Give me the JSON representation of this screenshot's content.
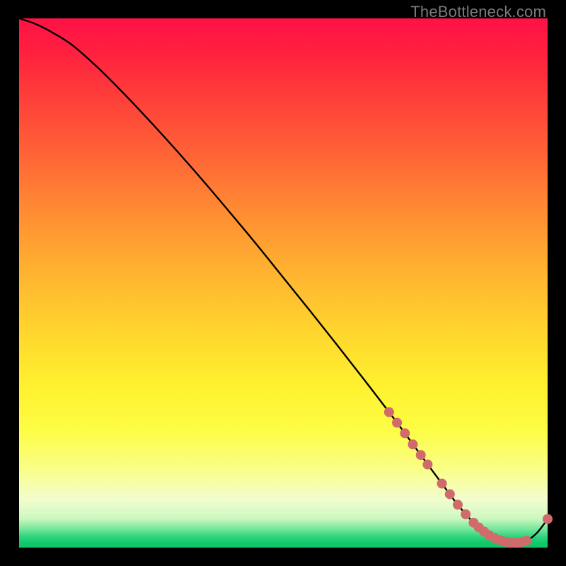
{
  "watermark": "TheBottleneck.com",
  "chart_data": {
    "type": "line",
    "title": "",
    "xlabel": "",
    "ylabel": "",
    "xlim": [
      0,
      100
    ],
    "ylim": [
      0,
      100
    ],
    "grid": false,
    "legend": false,
    "series": [
      {
        "name": "bottleneck-curve",
        "color": "#000000",
        "x": [
          0,
          3,
          6,
          10,
          15,
          20,
          25,
          30,
          35,
          40,
          45,
          50,
          55,
          60,
          65,
          70,
          73,
          76,
          80,
          83,
          86,
          88,
          90,
          92,
          94,
          96,
          98,
          100
        ],
        "y": [
          100,
          99,
          97.5,
          95,
          90.6,
          85.6,
          80.3,
          74.8,
          69.1,
          63.2,
          57.2,
          51.0,
          44.8,
          38.5,
          32.1,
          25.6,
          21.6,
          17.5,
          12.1,
          8.1,
          4.7,
          3.0,
          1.8,
          1.1,
          0.9,
          1.3,
          2.8,
          5.4
        ]
      }
    ],
    "markers": [
      {
        "x": 70.0,
        "y": 25.6
      },
      {
        "x": 71.5,
        "y": 23.6
      },
      {
        "x": 73.0,
        "y": 21.6
      },
      {
        "x": 74.5,
        "y": 19.5
      },
      {
        "x": 76.0,
        "y": 17.5
      },
      {
        "x": 77.3,
        "y": 15.7
      },
      {
        "x": 80.0,
        "y": 12.1
      },
      {
        "x": 81.5,
        "y": 10.1
      },
      {
        "x": 83.0,
        "y": 8.1
      },
      {
        "x": 84.5,
        "y": 6.3
      },
      {
        "x": 86.0,
        "y": 4.7
      },
      {
        "x": 87.0,
        "y": 3.8
      },
      {
        "x": 88.0,
        "y": 3.0
      },
      {
        "x": 89.0,
        "y": 2.3
      },
      {
        "x": 90.0,
        "y": 1.8
      },
      {
        "x": 91.0,
        "y": 1.4
      },
      {
        "x": 92.0,
        "y": 1.1
      },
      {
        "x": 93.0,
        "y": 0.95
      },
      {
        "x": 94.0,
        "y": 0.9
      },
      {
        "x": 95.0,
        "y": 1.05
      },
      {
        "x": 96.0,
        "y": 1.3
      },
      {
        "x": 100.0,
        "y": 5.4
      }
    ],
    "marker_color": "#d16a6a",
    "marker_radius": 7
  },
  "colors": {
    "background": "#000000",
    "curve": "#000000",
    "marker": "#d16a6a",
    "watermark": "#7a7a7a"
  }
}
